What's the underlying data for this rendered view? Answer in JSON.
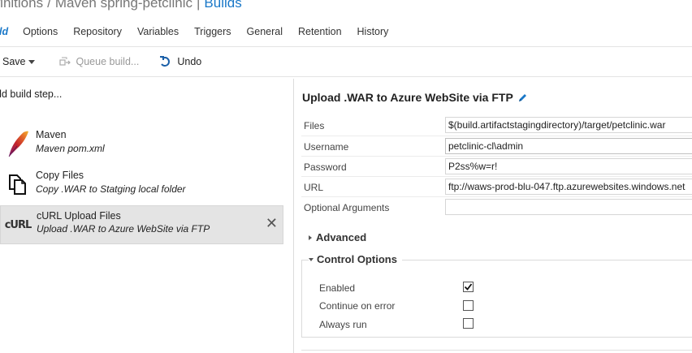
{
  "breadcrumb": {
    "root": "efinitions",
    "separator": "/",
    "middle": "Maven spring-petclinic",
    "separator2": "|",
    "current": "Builds"
  },
  "tabs": [
    {
      "label": "ld"
    },
    {
      "label": "Options"
    },
    {
      "label": "Repository"
    },
    {
      "label": "Variables"
    },
    {
      "label": "Triggers"
    },
    {
      "label": "General"
    },
    {
      "label": "Retention"
    },
    {
      "label": "History"
    }
  ],
  "toolbar": {
    "save_label": "Save",
    "queue_label": "Queue build...",
    "undo_label": "Undo"
  },
  "left_panel": {
    "add_step_label": "dd build step...",
    "steps": [
      {
        "title": "Maven",
        "subtitle": "Maven pom.xml",
        "icon": "maven-feather-icon"
      },
      {
        "title": "Copy Files",
        "subtitle": "Copy .WAR to Statging local folder",
        "icon": "copy-files-icon"
      },
      {
        "title": "cURL Upload Files",
        "subtitle": "Upload .WAR to Azure WebSite via FTP",
        "icon": "curl-icon",
        "icon_text": "cURL",
        "selected": true
      }
    ],
    "close_glyph": "✕"
  },
  "task": {
    "title": "Upload .WAR to Azure WebSite via FTP",
    "fields": [
      {
        "label": "Files",
        "value": "$(build.artifactstagingdirectory)/target/petclinic.war"
      },
      {
        "label": "Username",
        "value": "petclinic-cl\\admin"
      },
      {
        "label": "Password",
        "value": "P2ss%w=r!"
      },
      {
        "label": "URL",
        "value": "ftp://waws-prod-blu-047.ftp.azurewebsites.windows.net"
      },
      {
        "label": "Optional Arguments",
        "value": ""
      }
    ],
    "advanced_label": "Advanced",
    "control_options_label": "Control Options",
    "options": [
      {
        "label": "Enabled",
        "checked": true
      },
      {
        "label": "Continue on error",
        "checked": false
      },
      {
        "label": "Always run",
        "checked": false
      }
    ]
  },
  "colors": {
    "accent": "#1a78c8",
    "selected_bg": "#e4e4e4",
    "maven_red": "#c4242b"
  }
}
